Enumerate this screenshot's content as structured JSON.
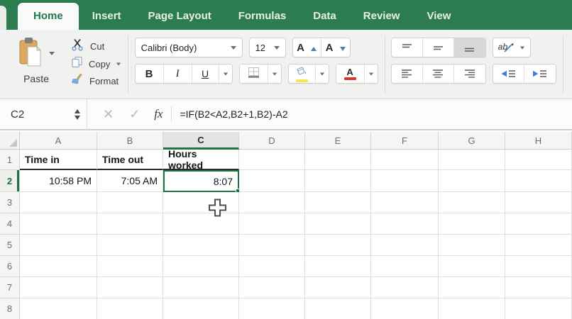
{
  "tab_bar": {
    "items": [
      {
        "label": "Home",
        "active": true
      },
      {
        "label": "Insert"
      },
      {
        "label": "Page Layout"
      },
      {
        "label": "Formulas"
      },
      {
        "label": "Data"
      },
      {
        "label": "Review"
      },
      {
        "label": "View"
      }
    ]
  },
  "ribbon": {
    "clipboard": {
      "paste_label": "Paste",
      "cut_label": "Cut",
      "copy_label": "Copy",
      "format_label": "Format"
    },
    "font": {
      "font_name": "Calibri (Body)",
      "font_size": "12",
      "bold_label": "B",
      "italic_label": "I",
      "underline_label": "U",
      "grow_font_label": "A",
      "shrink_font_label": "A",
      "font_color_label": "A",
      "orientation_label": "ab"
    }
  },
  "formula_bar": {
    "name_box": "C2",
    "cancel_icon": "✕",
    "enter_icon": "✓",
    "fx_label": "fx",
    "formula": "=IF(B2<A2,B2+1,B2)-A2"
  },
  "grid": {
    "column_headers": [
      "A",
      "B",
      "C",
      "D",
      "E",
      "F",
      "G",
      "H"
    ],
    "row_headers": [
      "1",
      "2",
      "3",
      "4",
      "5",
      "6",
      "7",
      "8"
    ],
    "active_column": "C",
    "active_row": "2",
    "selected_cell": "C2",
    "cells": [
      {
        "ref": "A1",
        "col": "A",
        "row": "1",
        "value": "Time in",
        "bold": true,
        "align": "left",
        "dark_bottom": true
      },
      {
        "ref": "B1",
        "col": "B",
        "row": "1",
        "value": "Time out",
        "bold": true,
        "align": "left",
        "dark_bottom": true
      },
      {
        "ref": "C1",
        "col": "C",
        "row": "1",
        "value": "Hours worked",
        "bold": true,
        "align": "left",
        "dark_bottom": true
      },
      {
        "ref": "A2",
        "col": "A",
        "row": "2",
        "value": "10:58 PM",
        "bold": false,
        "align": "right",
        "dark_bottom": false
      },
      {
        "ref": "B2",
        "col": "B",
        "row": "2",
        "value": "7:05 AM",
        "bold": false,
        "align": "right",
        "dark_bottom": false
      },
      {
        "ref": "C2",
        "col": "C",
        "row": "2",
        "value": "8:07",
        "bold": false,
        "align": "right",
        "dark_bottom": false
      }
    ]
  },
  "colors": {
    "excel_green": "#217346",
    "tab_bar_green": "#2d7c50",
    "fill_color_swatch": "#f3ea52",
    "font_color_swatch": "#d7372d"
  }
}
